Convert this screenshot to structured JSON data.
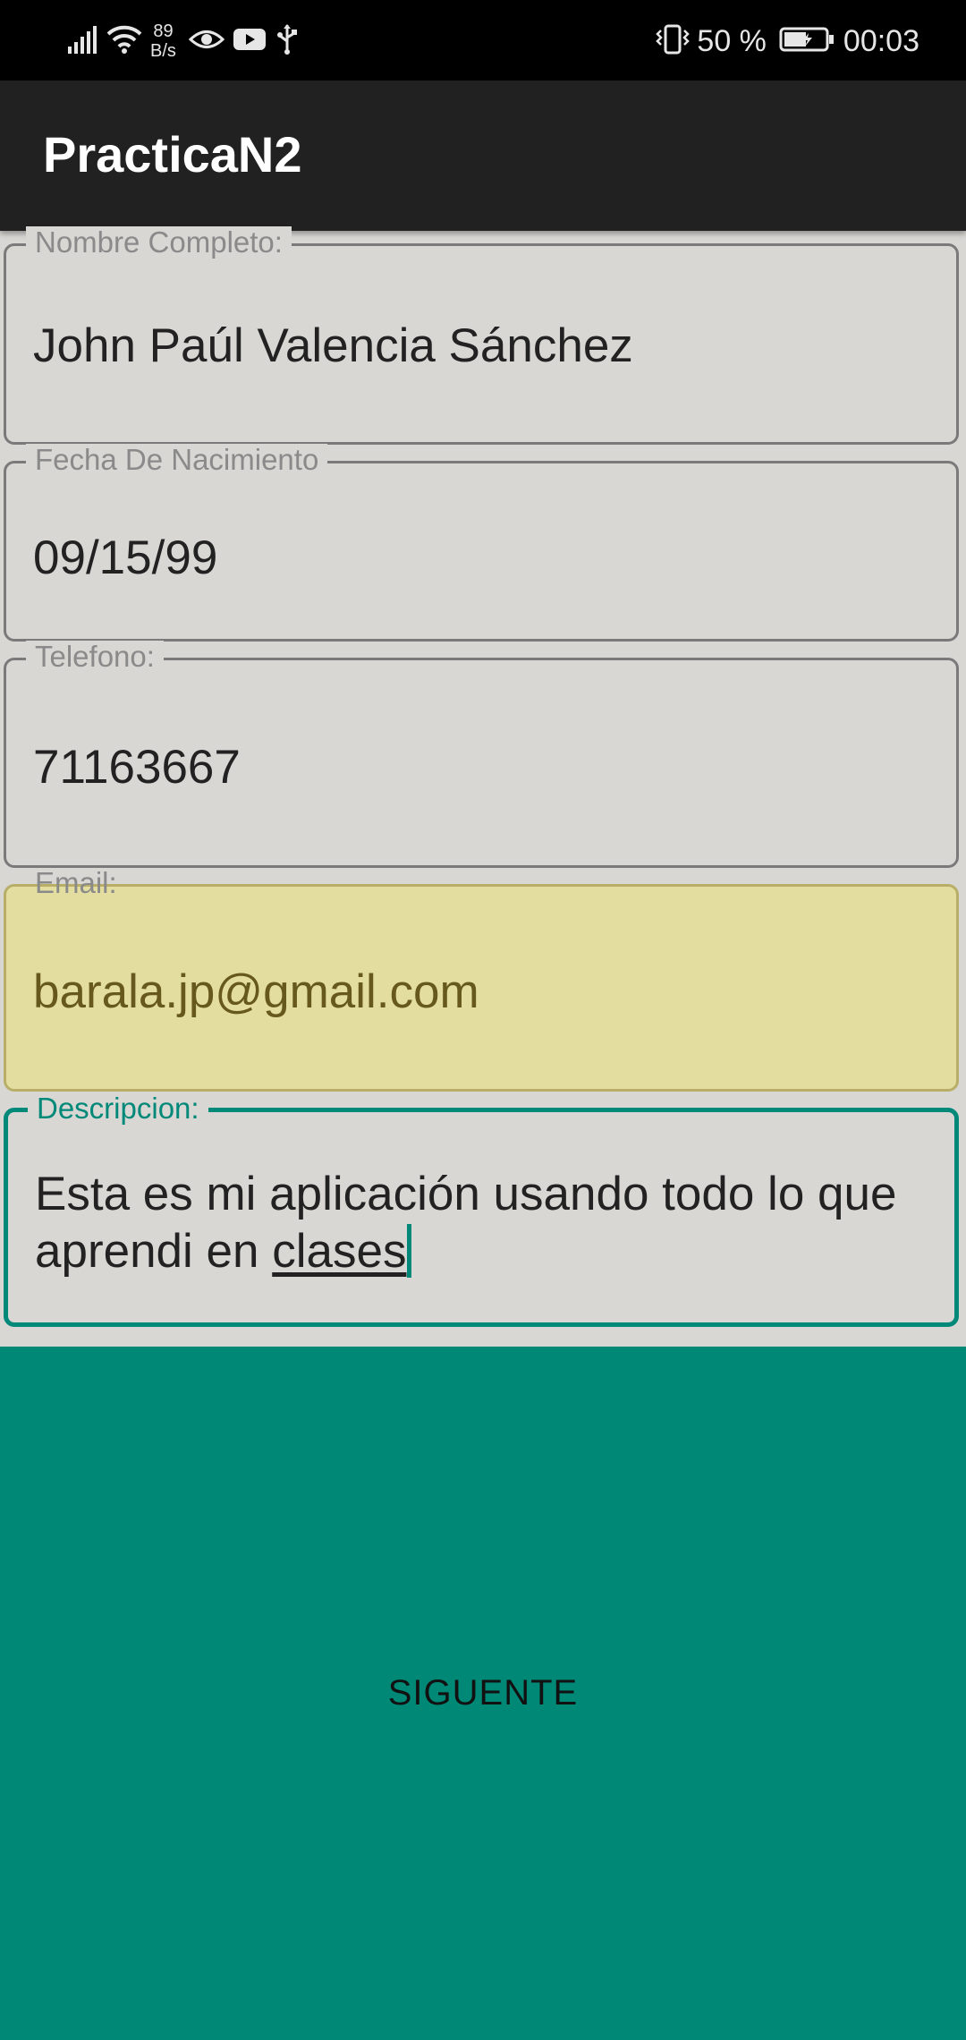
{
  "status_bar": {
    "net_speed_value": "89",
    "net_speed_unit": "B/s",
    "battery_percent": "50 %",
    "time": "00:03",
    "icons": [
      "signal-icon",
      "wifi-icon",
      "eye-icon",
      "youtube-icon",
      "usb-icon",
      "vibrate-icon",
      "battery-icon"
    ]
  },
  "app_bar": {
    "title": "PracticaN2"
  },
  "form": {
    "name": {
      "label": "Nombre Completo:",
      "value": "John Paúl Valencia Sánchez"
    },
    "birthdate": {
      "label": "Fecha De Nacimiento",
      "value": "09/15/99"
    },
    "phone": {
      "label": "Telefono:",
      "value": "71163667"
    },
    "email": {
      "label": "Email:",
      "value": "barala.jp@gmail.com"
    },
    "description": {
      "label": "Descripcion:",
      "value_line1": "Esta es mi aplicación usando todo lo que",
      "value_line2_plain": "aprendi en ",
      "value_line2_underlined": "clases"
    }
  },
  "actions": {
    "next_label": "SIGUENTE"
  },
  "colors": {
    "accent": "#008877",
    "app_bar": "#212121",
    "autofill": "#e3dea0",
    "background": "#d8d7d4"
  }
}
